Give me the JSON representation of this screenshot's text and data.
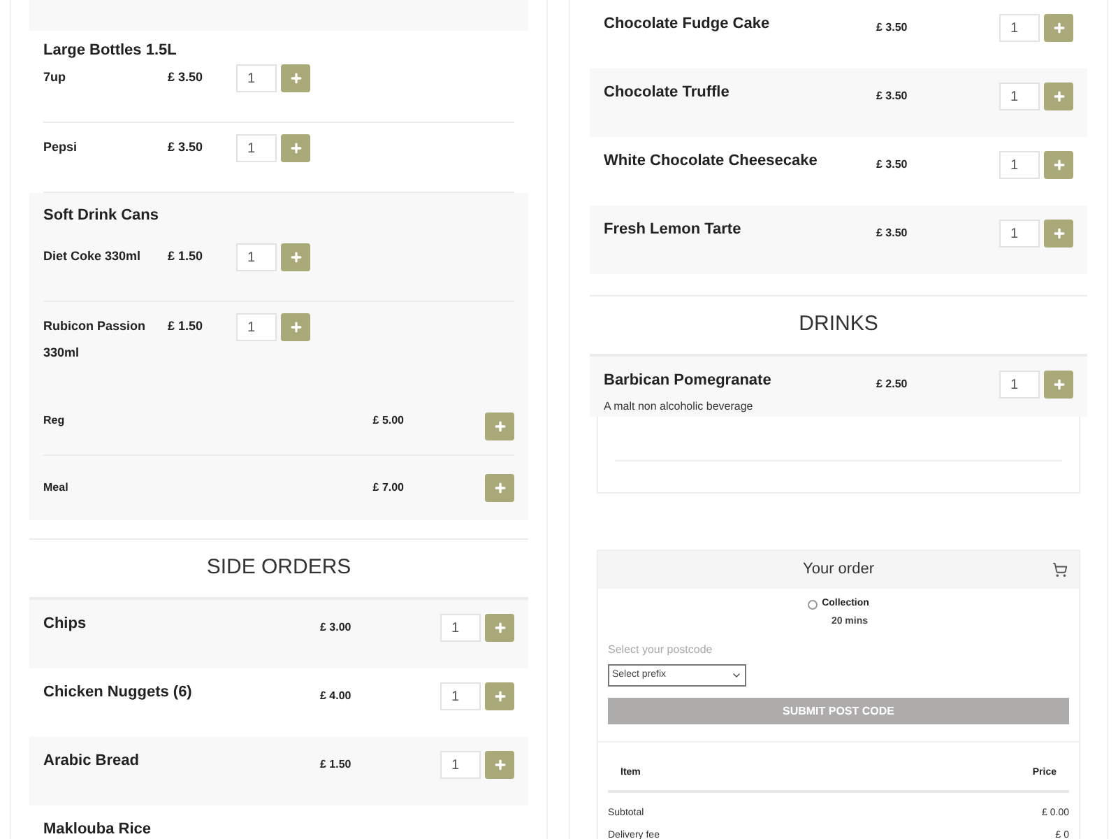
{
  "left_column": [
    {
      "kind": "subgroup",
      "title": "Large Bottles 1.5L",
      "items": [
        {
          "name": "7up",
          "price": "£ 3.50",
          "quantity": "1"
        },
        {
          "name": "Pepsi",
          "price": "£ 3.50",
          "quantity": "1"
        }
      ]
    },
    {
      "kind": "subgroup",
      "title": "Soft Drink Cans",
      "items": [
        {
          "name": "Diet Coke 330ml",
          "price": "£ 1.50",
          "quantity": "1"
        },
        {
          "name": "Rubicon Passion 330ml",
          "price": "£ 1.50",
          "quantity": "1"
        }
      ]
    },
    {
      "kind": "options",
      "items": [
        {
          "name": "Reg",
          "price": "£ 5.00"
        },
        {
          "name": "Meal",
          "price": "£ 7.00"
        }
      ]
    },
    {
      "kind": "category",
      "title": "SIDE ORDERS",
      "items": [
        {
          "name": "Chips",
          "price": "£ 3.00",
          "quantity": "1"
        },
        {
          "name": "Chicken Nuggets (6)",
          "price": "£ 4.00",
          "quantity": "1"
        },
        {
          "name": "Arabic Bread",
          "price": "£ 1.50",
          "quantity": "1"
        },
        {
          "name": "Maklouba Rice"
        }
      ]
    }
  ],
  "right_column": [
    {
      "kind": "list",
      "items": [
        {
          "name": "Chocolate Fudge Cake",
          "price": "£ 3.50",
          "quantity": "1"
        },
        {
          "name": "Chocolate Truffle",
          "price": "£ 3.50",
          "quantity": "1"
        },
        {
          "name": "White Chocolate Cheesecake",
          "price": "£ 3.50",
          "quantity": "1"
        },
        {
          "name": "Fresh Lemon Tarte",
          "price": "£ 3.50",
          "quantity": "1"
        }
      ]
    },
    {
      "kind": "category",
      "title": "DRINKS",
      "items": [
        {
          "name": "Barbican Pomegranate",
          "price": "£ 2.50",
          "quantity": "1",
          "description": "A malt non alcoholic beverage"
        }
      ]
    }
  ],
  "order": {
    "title": "Your order",
    "delivery_options": [
      {
        "label": "Collection",
        "time": "20 mins",
        "selected": false
      }
    ],
    "postcode_label": "Select your postcode",
    "prefix_select": "Select prefix",
    "submit_button": "SUBMIT POST CODE",
    "columns": [
      "Item",
      "Price"
    ],
    "totals": [
      {
        "label": "Subtotal",
        "value": "£ 0.00"
      },
      {
        "label": "Delivery fee",
        "value": "£ 0"
      }
    ]
  }
}
